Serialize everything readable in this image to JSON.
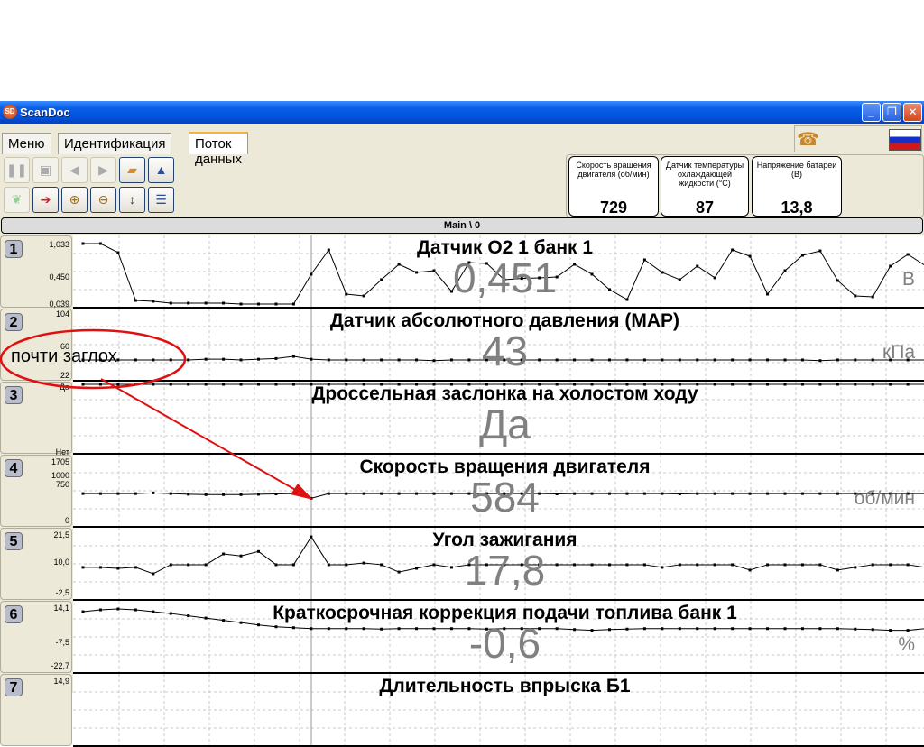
{
  "window": {
    "title": "ScanDoc",
    "logo": "SD",
    "controls": [
      "minimize",
      "restore",
      "close"
    ]
  },
  "tabs": [
    {
      "label": "Меню",
      "active": false
    },
    {
      "label": "Идентификация",
      "active": false
    },
    {
      "label": "Поток данных",
      "active": true
    }
  ],
  "toolbar": {
    "row1": [
      {
        "icon": "pause-icon",
        "enabled": false
      },
      {
        "icon": "save-icon",
        "enabled": false
      },
      {
        "icon": "back-icon",
        "enabled": false
      },
      {
        "icon": "forward-icon",
        "enabled": false
      },
      {
        "icon": "open-folder-icon",
        "enabled": true
      },
      {
        "icon": "oscilloscope-icon",
        "enabled": true
      }
    ],
    "row2": [
      {
        "icon": "leaf-icon",
        "enabled": false
      },
      {
        "icon": "export-icon",
        "enabled": true
      },
      {
        "icon": "zoom-in-icon",
        "enabled": true
      },
      {
        "icon": "zoom-out-icon",
        "enabled": true
      },
      {
        "icon": "zoom-vertical-icon",
        "enabled": true
      },
      {
        "icon": "list-icon",
        "enabled": true
      }
    ]
  },
  "header_icons": [
    "phone-icon",
    "russia-flag-icon"
  ],
  "cards": [
    {
      "label": "Скорость вращения двигателя (об/мин)",
      "value": "729"
    },
    {
      "label": "Датчик температуры охлаждающей жидкости (°C)",
      "value": "87"
    },
    {
      "label": "Напряжение батареи (В)",
      "value": "13,8"
    }
  ],
  "main_bar": "Main \\ 0",
  "annotation": {
    "text": "почти заглох",
    "color": "#E01010"
  },
  "chart_data": [
    {
      "type": "line",
      "index": "1",
      "title": "Датчик O2 1 банк 1",
      "value": "0,451",
      "unit": "В",
      "axis_labels": [
        "1,033",
        "0,450",
        "0,039"
      ],
      "ylim": [
        0.039,
        1.033
      ],
      "values": [
        1.033,
        1.033,
        0.885,
        0.098,
        0.084,
        0.054,
        0.054,
        0.054,
        0.054,
        0.039,
        0.039,
        0.039,
        0.039,
        0.529,
        0.929,
        0.202,
        0.173,
        0.44,
        0.692,
        0.559,
        0.588,
        0.247,
        0.722,
        0.707,
        0.44,
        0.46,
        0.47,
        0.484,
        0.692,
        0.529,
        0.277,
        0.113,
        0.766,
        0.559,
        0.44,
        0.662,
        0.47,
        0.929,
        0.825,
        0.202,
        0.588,
        0.84,
        0.914,
        0.425,
        0.173,
        0.158,
        0.662,
        0.855,
        0.67
      ]
    },
    {
      "type": "line",
      "index": "2",
      "title": "Датчик абсолютного давления (MAP)",
      "value": "43",
      "unit": "кПа",
      "axis_labels": [
        "104",
        "60",
        "22"
      ],
      "ylim": [
        22,
        104
      ],
      "values": [
        40,
        40,
        40,
        40,
        40,
        40,
        40,
        41,
        41,
        40,
        41,
        42,
        45,
        41,
        40,
        40,
        40,
        40,
        40,
        40,
        39,
        40,
        40,
        40,
        40,
        40,
        40,
        40,
        40,
        40,
        40,
        40,
        40,
        40,
        40,
        40,
        40,
        40,
        40,
        40,
        40,
        40,
        39,
        40,
        40,
        40,
        40,
        40,
        40
      ]
    },
    {
      "type": "line",
      "index": "3",
      "title": "Дроссельная заслонка на холостом ходу",
      "value": "Да",
      "unit": "",
      "axis_labels": [
        "Да",
        "Нет"
      ],
      "ylim": [
        0,
        1
      ],
      "values": [
        1,
        1,
        1,
        1,
        1,
        1,
        1,
        1,
        1,
        1,
        1,
        1,
        1,
        1,
        1,
        1,
        1,
        1,
        1,
        1,
        1,
        1,
        1,
        1,
        1,
        1,
        1,
        1,
        1,
        1,
        1,
        1,
        1,
        1,
        1,
        1,
        1,
        1,
        1,
        1,
        1,
        1,
        1,
        1,
        1,
        1,
        1,
        1,
        1
      ]
    },
    {
      "type": "line",
      "index": "4",
      "title": "Скорость вращения двигателя",
      "value": "584",
      "unit": "об/мин",
      "axis_labels": [
        "1705",
        "1000",
        "750",
        "0"
      ],
      "ylim": [
        0,
        1705
      ],
      "values": [
        720,
        720,
        720,
        720,
        740,
        720,
        700,
        690,
        690,
        690,
        700,
        710,
        720,
        584,
        720,
        720,
        720,
        720,
        720,
        720,
        720,
        720,
        720,
        720,
        720,
        720,
        720,
        710,
        720,
        720,
        720,
        720,
        720,
        720,
        710,
        720,
        720,
        720,
        720,
        720,
        720,
        720,
        720,
        720,
        720,
        720,
        720,
        720,
        720
      ]
    },
    {
      "type": "line",
      "index": "5",
      "title": "Угол зажигания",
      "value": "17,8",
      "unit": "",
      "axis_labels": [
        "21,5",
        "10,0",
        "-2,5"
      ],
      "ylim": [
        -2.5,
        21.5
      ],
      "values": [
        7.5,
        7.5,
        7.1,
        7.5,
        4.9,
        8.6,
        8.6,
        8.6,
        13,
        12.2,
        14,
        8.6,
        8.6,
        20,
        8.6,
        8.6,
        9.3,
        8.6,
        5.6,
        7.1,
        8.6,
        7.5,
        8.6,
        8.6,
        8.6,
        8.6,
        8.6,
        8.6,
        8.6,
        8.6,
        8.6,
        8.6,
        8.6,
        7.5,
        8.6,
        8.6,
        8.6,
        8.6,
        6.4,
        8.6,
        8.6,
        8.6,
        8.6,
        6.4,
        7.5,
        8.6,
        8.6,
        8.6,
        7.5
      ]
    },
    {
      "type": "line",
      "index": "6",
      "title": "Краткосрочная коррекция подачи топлива банк 1",
      "value": "-0,6",
      "unit": "%",
      "axis_labels": [
        "14,1",
        "-7,5",
        "-22,7"
      ],
      "ylim": [
        -22.7,
        14.1
      ],
      "values": [
        11.7,
        12.9,
        13.5,
        12.9,
        11.7,
        10.5,
        9,
        7.5,
        6,
        4.5,
        3,
        1.8,
        1.2,
        0.6,
        0.6,
        0.6,
        0.6,
        0.3,
        0.6,
        0.6,
        0.6,
        0.6,
        0.6,
        0.3,
        0.6,
        0.6,
        0.6,
        0.6,
        0,
        -0.5,
        0,
        0.3,
        0.6,
        0.6,
        0.6,
        0.6,
        0.6,
        0.6,
        0.6,
        0.6,
        0.6,
        0.6,
        0.6,
        0.6,
        0.3,
        0,
        -0.5,
        -0.5,
        0.6
      ]
    },
    {
      "type": "line",
      "index": "7",
      "title": "Длительность впрыска Б1",
      "value": "",
      "unit": "",
      "axis_labels": [
        "14,9"
      ],
      "ylim": [
        0,
        14.9
      ],
      "values": []
    }
  ]
}
